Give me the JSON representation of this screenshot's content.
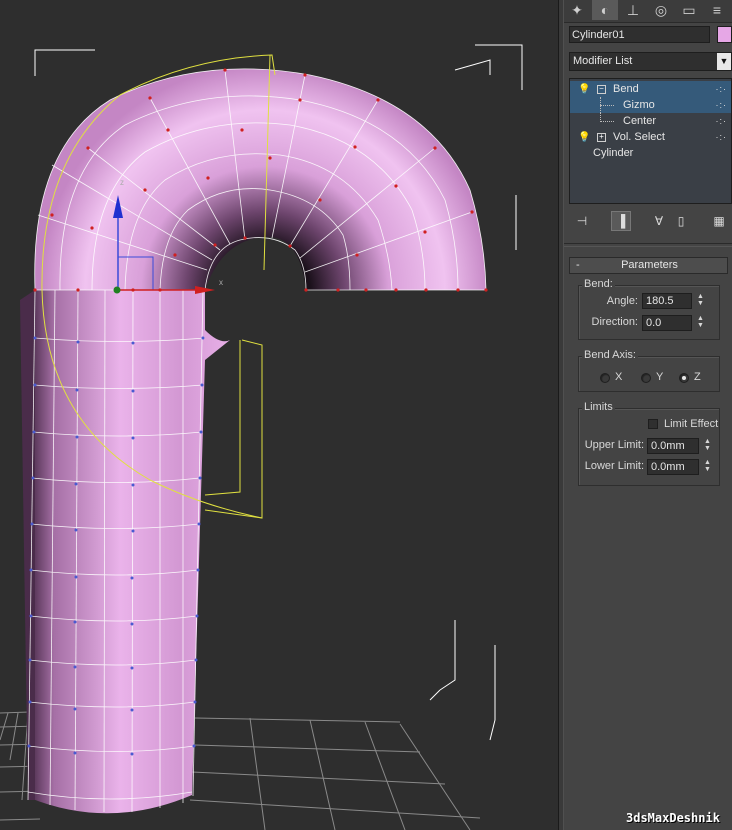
{
  "viewport": {
    "axis_x_label": "x",
    "axis_z_label": "z"
  },
  "command_panel": {
    "tabs": [
      {
        "name": "create-tab",
        "glyph": "✦"
      },
      {
        "name": "modify-tab",
        "glyph": "◐"
      },
      {
        "name": "hierarchy-tab",
        "glyph": "⊥"
      },
      {
        "name": "motion-tab",
        "glyph": "◎"
      },
      {
        "name": "display-tab",
        "glyph": "▭"
      },
      {
        "name": "utilities-tab",
        "glyph": "≡"
      }
    ],
    "object_name": "Cylinder01",
    "object_color": "#e6a7e6",
    "modifier_list_label": "Modifier List",
    "stack": [
      {
        "label": "Bend",
        "level": 0,
        "selected": true,
        "expanded": true
      },
      {
        "label": "Gizmo",
        "level": 1,
        "selected": true
      },
      {
        "label": "Center",
        "level": 1,
        "selected": false
      },
      {
        "label": "Vol. Select",
        "level": 0,
        "selected": false,
        "expanded": false
      },
      {
        "label": "Cylinder",
        "level": 0,
        "selected": false
      }
    ],
    "parameters": {
      "rollout_title": "Parameters",
      "bend_group": "Bend:",
      "angle_label": "Angle:",
      "angle_value": "180.5",
      "direction_label": "Direction:",
      "direction_value": "0.0",
      "bend_axis_group": "Bend Axis:",
      "axis_x": "X",
      "axis_y": "Y",
      "axis_z": "Z",
      "selected_axis": "Z",
      "limits_group": "Limits",
      "limit_effect_label": "Limit Effect",
      "limit_effect_checked": false,
      "upper_limit_label": "Upper Limit:",
      "upper_limit_value": "0.0mm",
      "lower_limit_label": "Lower Limit:",
      "lower_limit_value": "0.0mm"
    }
  },
  "watermark": "3dsMaxDeshnik",
  "colors": {
    "mesh": "#d9a0d9",
    "gizmo": "#e0e040",
    "selection_blue": "#355a7a"
  }
}
